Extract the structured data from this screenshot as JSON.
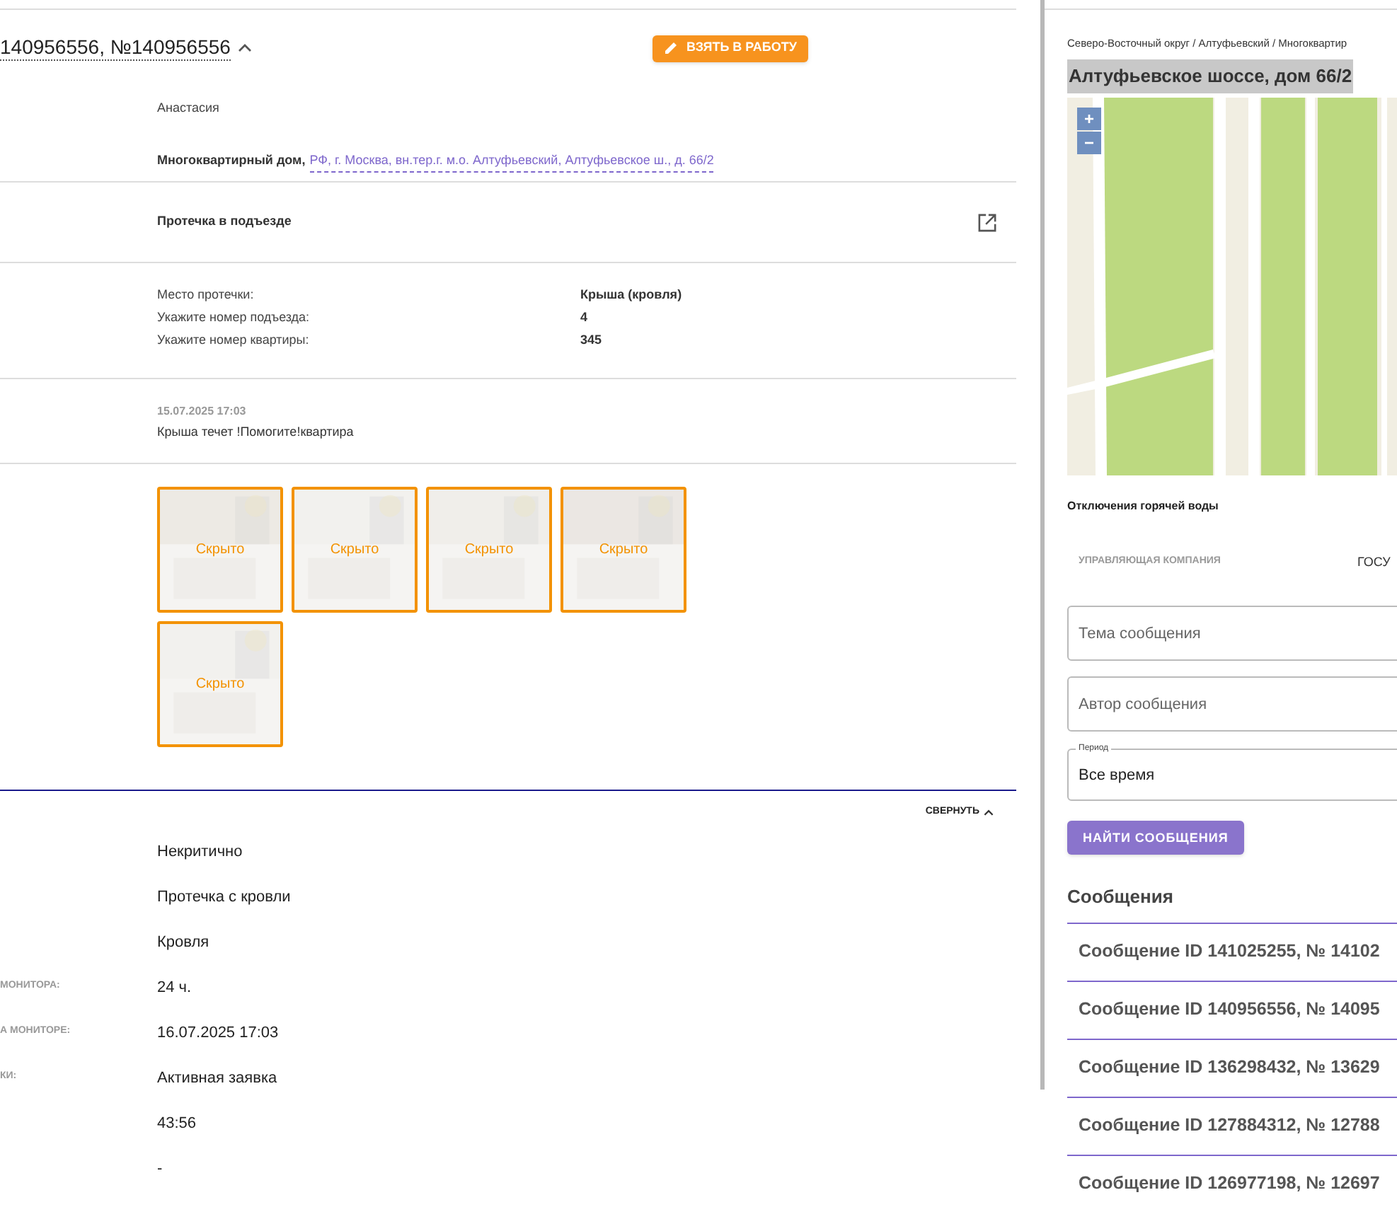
{
  "request": {
    "title": "140956556, №140956556",
    "take_button": "ВЗЯТЬ В РАБОТУ",
    "applicant": "Анастасия",
    "object_type": "Многоквартирный дом,",
    "address_link": "РФ, г. Москва, вн.тер.г. м.о. Алтуфьевский, Алтуфьевское ш., д. 66/2",
    "topic": "Протечка в подъезде",
    "fields": [
      {
        "label": "Место протечки:",
        "value": "Крыша (кровля)"
      },
      {
        "label": "Укажите номер подъезда:",
        "value": "4"
      },
      {
        "label": "Укажите номер квартиры:",
        "value": "345"
      }
    ],
    "comment_date": "15.07.2025 17:03",
    "comment": "Крыша течет !Помогите!квартира",
    "photos": [
      {
        "label": "Скрыто"
      },
      {
        "label": "Скрыто"
      },
      {
        "label": "Скрыто"
      },
      {
        "label": "Скрыто"
      },
      {
        "label": "Скрыто"
      }
    ]
  },
  "details": {
    "collapse": "СВЕРНУТЬ",
    "rows": [
      {
        "value": "Некритично"
      },
      {
        "value": "Протечка с кровли"
      },
      {
        "value": "Кровля"
      },
      {
        "label": "МОНИТОРА:",
        "value": "24 ч."
      },
      {
        "label": "А МОНИТОРЕ:",
        "value": "16.07.2025 17:03"
      },
      {
        "label": "КИ:",
        "value": "Активная заявка"
      },
      {
        "value": "43:56"
      },
      {
        "value": "-"
      }
    ]
  },
  "side": {
    "breadcrumb": "Северо-Восточный округ / Алтуфьевский / Многоквартир",
    "heading": "Алтуфьевское шоссе, дом 66/2",
    "zoom_in": "+",
    "zoom_out": "−",
    "hot_water": "Отключения горячей воды",
    "company_label": "УПРАВЛЯЮЩАЯ КОМПАНИЯ",
    "company_value": "ГОСУ",
    "subject_placeholder": "Тема сообщения",
    "author_placeholder": "Автор сообщения",
    "period_label": "Период",
    "period_value": "Все время",
    "find_button": "НАЙТИ СООБЩЕНИЯ",
    "messages_title": "Сообщения",
    "messages": [
      "Сообщение ID 141025255, № 14102",
      "Сообщение ID 140956556, № 14095",
      "Сообщение ID 136298432, № 13629",
      "Сообщение ID 127884312, № 12788",
      "Сообщение ID 126977198, № 12697"
    ]
  }
}
